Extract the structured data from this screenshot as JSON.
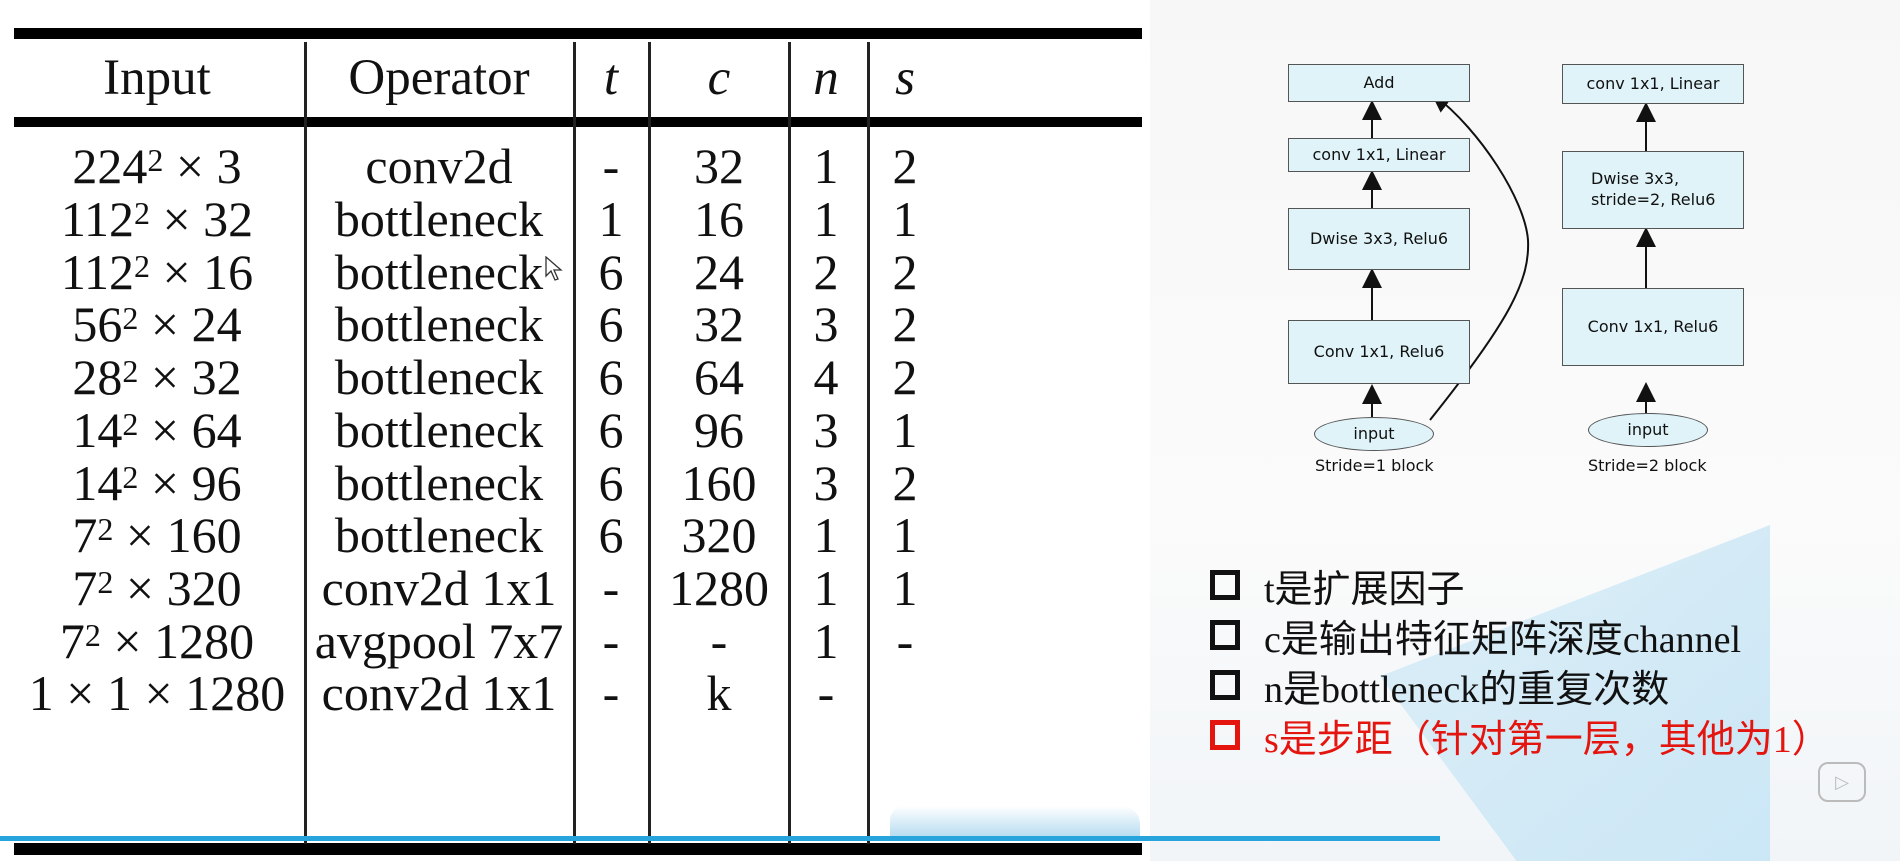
{
  "table": {
    "headers": [
      {
        "text": "Input",
        "italic": false
      },
      {
        "text": "Operator",
        "italic": false
      },
      {
        "text": "t",
        "italic": true
      },
      {
        "text": "c",
        "italic": true
      },
      {
        "text": "n",
        "italic": true
      },
      {
        "text": "s",
        "italic": true
      }
    ],
    "rows": [
      {
        "input": {
          "base": "224",
          "exp": "2",
          "rest": " × 3"
        },
        "operator": "conv2d",
        "t": "-",
        "c": "32",
        "n": "1",
        "s": "2"
      },
      {
        "input": {
          "base": "112",
          "exp": "2",
          "rest": " × 32"
        },
        "operator": "bottleneck",
        "t": "1",
        "c": "16",
        "n": "1",
        "s": "1"
      },
      {
        "input": {
          "base": "112",
          "exp": "2",
          "rest": " × 16"
        },
        "operator": "bottleneck",
        "t": "6",
        "c": "24",
        "n": "2",
        "s": "2"
      },
      {
        "input": {
          "base": "56",
          "exp": "2",
          "rest": " × 24"
        },
        "operator": "bottleneck",
        "t": "6",
        "c": "32",
        "n": "3",
        "s": "2"
      },
      {
        "input": {
          "base": "28",
          "exp": "2",
          "rest": " × 32"
        },
        "operator": "bottleneck",
        "t": "6",
        "c": "64",
        "n": "4",
        "s": "2"
      },
      {
        "input": {
          "base": "14",
          "exp": "2",
          "rest": " × 64"
        },
        "operator": "bottleneck",
        "t": "6",
        "c": "96",
        "n": "3",
        "s": "1"
      },
      {
        "input": {
          "base": "14",
          "exp": "2",
          "rest": " × 96"
        },
        "operator": "bottleneck",
        "t": "6",
        "c": "160",
        "n": "3",
        "s": "2"
      },
      {
        "input": {
          "base": "7",
          "exp": "2",
          "rest": " × 160"
        },
        "operator": "bottleneck",
        "t": "6",
        "c": "320",
        "n": "1",
        "s": "1"
      },
      {
        "input": {
          "base": "7",
          "exp": "2",
          "rest": " × 320"
        },
        "operator": "conv2d 1x1",
        "t": "-",
        "c": "1280",
        "n": "1",
        "s": "1"
      },
      {
        "input": {
          "base": "7",
          "exp": "2",
          "rest": " × 1280"
        },
        "operator": "avgpool 7x7",
        "t": "-",
        "c": "-",
        "n": "1",
        "s": "-"
      },
      {
        "input": {
          "base": "1 × 1 × 1280",
          "exp": "",
          "rest": ""
        },
        "operator": "conv2d 1x1",
        "t": "-",
        "c": "k",
        "n": "-",
        "s": ""
      }
    ]
  },
  "diagram": {
    "stride1": {
      "boxes": [
        "Add",
        "conv 1x1, Linear",
        "Dwise 3x3, Relu6",
        "Conv 1x1, Relu6"
      ],
      "input": "input",
      "caption": "Stride=1 block"
    },
    "stride2": {
      "boxes": [
        "conv 1x1, Linear",
        "Dwise 3x3,\nstride=2, Relu6",
        "Conv 1x1, Relu6"
      ],
      "input": "input",
      "caption": "Stride=2 block"
    },
    "box_fill": "#dff3f8"
  },
  "legend": {
    "items": [
      {
        "text": "t是扩展因子",
        "highlight": false
      },
      {
        "text": "c是输出特征矩阵深度channel",
        "highlight": false
      },
      {
        "text": "n是bottleneck的重复次数",
        "highlight": false
      },
      {
        "text": "s是步距（针对第一层，其他为1）",
        "highlight": true
      }
    ],
    "highlight_color": "#e4140f"
  },
  "player": {
    "progress_color": "#28a4dc",
    "play_icon": "play-icon",
    "cursor_icon": "mouse-cursor-icon"
  }
}
